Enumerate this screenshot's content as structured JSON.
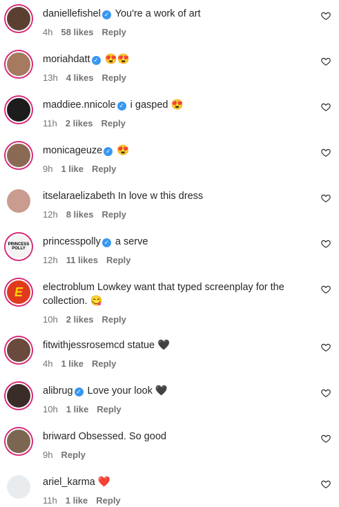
{
  "comments": [
    {
      "user": "daniellefishel",
      "verified": true,
      "text": "You're a work of art",
      "time": "4h",
      "likes": "58 likes",
      "reply": "Reply",
      "ring": true,
      "avatar_color": "#5b4032"
    },
    {
      "user": "moriahdatt",
      "verified": true,
      "text": "😍😍",
      "time": "13h",
      "likes": "4 likes",
      "reply": "Reply",
      "ring": true,
      "avatar_color": "#a57a5e"
    },
    {
      "user": "maddiee.nnicole",
      "verified": true,
      "text": "i gasped 😍",
      "time": "11h",
      "likes": "2 likes",
      "reply": "Reply",
      "ring": true,
      "avatar_color": "#1c1c1c"
    },
    {
      "user": "monicageuze",
      "verified": true,
      "text": "😍",
      "time": "9h",
      "likes": "1 like",
      "reply": "Reply",
      "ring": true,
      "avatar_color": "#8b6a55"
    },
    {
      "user": "itselaraelizabeth",
      "verified": false,
      "text": "In love w this dress",
      "time": "12h",
      "likes": "8 likes",
      "reply": "Reply",
      "ring": false,
      "avatar_color": "#c99c8f"
    },
    {
      "user": "princesspolly",
      "verified": true,
      "text": "a serve",
      "time": "12h",
      "likes": "11 likes",
      "reply": "Reply",
      "ring": true,
      "avatar_color": "#f3f3f3",
      "avatar_text": "PRINCESS POLLY"
    },
    {
      "user": "electroblum",
      "verified": false,
      "text": "Lowkey want that typed screenplay for the collection. 😋",
      "time": "10h",
      "likes": "2 likes",
      "reply": "Reply",
      "ring": true,
      "avatar_color": "#e03a1e",
      "avatar_text": "E"
    },
    {
      "user": "fitwithjessrosemcd",
      "verified": false,
      "text": "statue 🖤",
      "time": "4h",
      "likes": "1 like",
      "reply": "Reply",
      "ring": true,
      "avatar_color": "#6a4a3c"
    },
    {
      "user": "alibrug",
      "verified": true,
      "text": "Love your look 🖤",
      "time": "10h",
      "likes": "1 like",
      "reply": "Reply",
      "ring": true,
      "avatar_color": "#3a2c28"
    },
    {
      "user": "briward",
      "verified": false,
      "text": "Obsessed. So good",
      "time": "9h",
      "likes": "",
      "reply": "Reply",
      "ring": true,
      "avatar_color": "#7b6652"
    },
    {
      "user": "ariel_karma",
      "verified": false,
      "text": "❤️",
      "time": "11h",
      "likes": "1 like",
      "reply": "Reply",
      "ring": false,
      "avatar_color": "#e8ecef"
    }
  ],
  "colors": {
    "accent": "#3897f0",
    "ring": "#d62976",
    "muted": "#737373",
    "text": "#262626"
  },
  "icons": {
    "like": "heart-outline-icon",
    "verified": "verified-badge-icon"
  }
}
